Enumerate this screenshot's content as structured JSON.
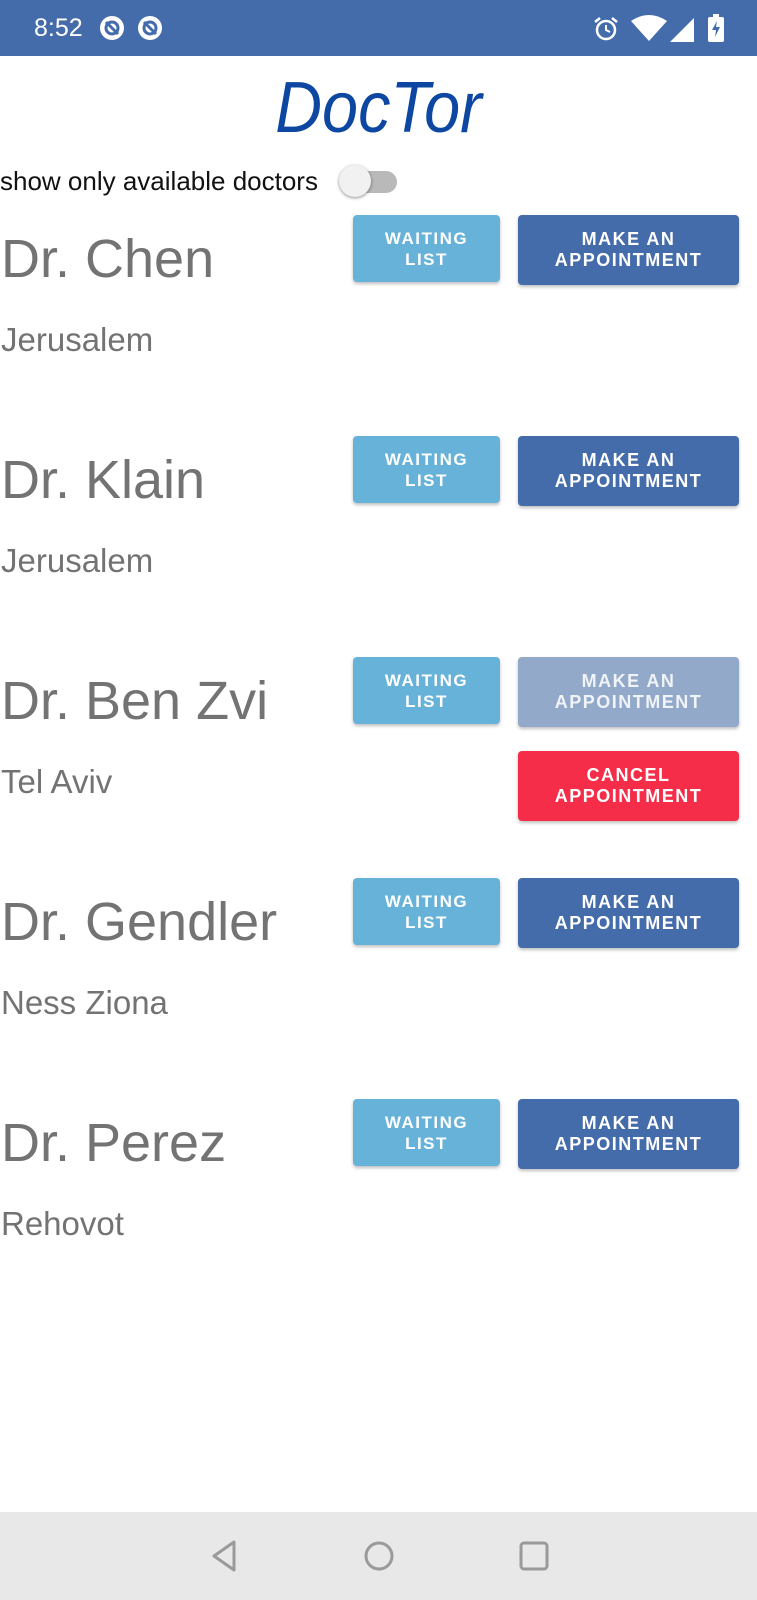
{
  "status_bar": {
    "time": "8:52",
    "icons": [
      "sync-icon",
      "sync-icon",
      "alarm-icon",
      "wifi-icon",
      "signal-icon",
      "battery-icon"
    ],
    "color": "#456caa"
  },
  "app": {
    "title": "DocTor",
    "title_color": "#0d47a1"
  },
  "filter": {
    "label": "show only available doctors",
    "enabled": false
  },
  "doctors": [
    {
      "name": "Dr. Chen",
      "city": "Jerusalem",
      "waiting_label": "WAITING LIST",
      "appointment_label": "MAKE AN APPOINTMENT",
      "appointment_enabled": true
    },
    {
      "name": "Dr. Klain",
      "city": "Jerusalem",
      "waiting_label": "WAITING LIST",
      "appointment_label": "MAKE AN APPOINTMENT",
      "appointment_enabled": true
    },
    {
      "name": "Dr. Ben Zvi",
      "city": "Tel Aviv",
      "waiting_label": "WAITING LIST",
      "appointment_label": "MAKE AN APPOINTMENT",
      "appointment_enabled": false,
      "cancel_label": "CANCEL APPOINTMENT"
    },
    {
      "name": "Dr. Gendler",
      "city": "Ness Ziona",
      "waiting_label": "WAITING LIST",
      "appointment_label": "MAKE AN APPOINTMENT",
      "appointment_enabled": true
    },
    {
      "name": "Dr. Perez",
      "city": "Rehovot",
      "waiting_label": "WAITING LIST",
      "appointment_label": "MAKE AN APPOINTMENT",
      "appointment_enabled": true
    }
  ],
  "colors": {
    "waiting_button": "#67b2d9",
    "appointment_button": "#456caa",
    "appointment_disabled": "#93a9c9",
    "cancel_button": "#f52d49",
    "doctor_text": "#737373"
  },
  "nav_bar": {
    "buttons": [
      "back-icon",
      "home-icon",
      "recents-icon"
    ]
  }
}
